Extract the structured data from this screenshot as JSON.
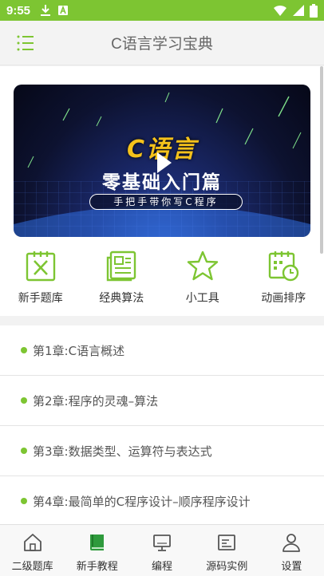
{
  "status_bar": {
    "time": "9:55",
    "left_icons": [
      "download-icon",
      "a-icon"
    ],
    "right_icons": [
      "wifi-icon",
      "signal-icon",
      "battery-icon"
    ],
    "color": "#7dc532"
  },
  "app_bar": {
    "title": "C语言学习宝典",
    "menu_icon": "list-menu-icon"
  },
  "banner": {
    "logo_text": "C语言",
    "headline": "零基础入门篇",
    "subline": "手把手带你写C程序",
    "play_icon": "play-icon"
  },
  "quick_actions": [
    {
      "label": "新手题库",
      "icon": "exam-icon"
    },
    {
      "label": "经典算法",
      "icon": "document-icon"
    },
    {
      "label": "小工具",
      "icon": "star-icon"
    },
    {
      "label": "动画排序",
      "icon": "calendar-clock-icon"
    }
  ],
  "chapters": [
    {
      "title": "第1章:C语言概述"
    },
    {
      "title": "第2章:程序的灵魂–算法"
    },
    {
      "title": "第3章:数据类型、运算符与表达式"
    },
    {
      "title": "第4章:最简单的C程序设计–顺序程序设计"
    }
  ],
  "bottom_nav": [
    {
      "label": "二级题库",
      "icon": "home-icon",
      "active": false
    },
    {
      "label": "新手教程",
      "icon": "book-icon",
      "active": true
    },
    {
      "label": "编程",
      "icon": "monitor-icon",
      "active": false
    },
    {
      "label": "源码实例",
      "icon": "code-window-icon",
      "active": false
    },
    {
      "label": "设置",
      "icon": "user-icon",
      "active": false
    }
  ],
  "colors": {
    "accent": "#7dc532",
    "text": "#333333",
    "muted": "#666666"
  }
}
